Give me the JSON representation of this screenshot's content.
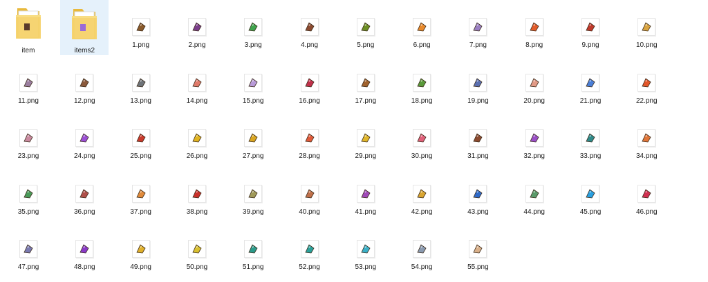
{
  "folders": [
    {
      "name": "item",
      "selected": false
    },
    {
      "name": "items2",
      "selected": true
    }
  ],
  "files": [
    {
      "name": "1.png",
      "icon": "treasure-chest-icon",
      "color": "#8a5a2b"
    },
    {
      "name": "2.png",
      "icon": "potion-bottle-icon",
      "color": "#7a3e8a"
    },
    {
      "name": "3.png",
      "icon": "clover-icon",
      "color": "#3fa34d"
    },
    {
      "name": "4.png",
      "icon": "wood-log-icon",
      "color": "#8b4a2f"
    },
    {
      "name": "5.png",
      "icon": "green-feather-icon",
      "color": "#6b8e23"
    },
    {
      "name": "6.png",
      "icon": "orange-star-icon",
      "color": "#e8892b"
    },
    {
      "name": "7.png",
      "icon": "crystal-gem-icon",
      "color": "#9a7fc2"
    },
    {
      "name": "8.png",
      "icon": "fire-orb-icon",
      "color": "#e25b2a"
    },
    {
      "name": "9.png",
      "icon": "staff-icon",
      "color": "#c0392b"
    },
    {
      "name": "10.png",
      "icon": "map-scroll-icon",
      "color": "#d9a441"
    },
    {
      "name": "11.png",
      "icon": "seashell-icon",
      "color": "#9b7ea0"
    },
    {
      "name": "12.png",
      "icon": "starfish-icon",
      "color": "#8b5a3c"
    },
    {
      "name": "13.png",
      "icon": "stone-pile-icon",
      "color": "#6e7378"
    },
    {
      "name": "14.png",
      "icon": "meat-icon",
      "color": "#e07a6a"
    },
    {
      "name": "15.png",
      "icon": "lilac-shell-icon",
      "color": "#b89ad8"
    },
    {
      "name": "16.png",
      "icon": "red-feather-icon",
      "color": "#c0304a"
    },
    {
      "name": "17.png",
      "icon": "acorn-icon",
      "color": "#a0622d"
    },
    {
      "name": "18.png",
      "icon": "cactus-icon",
      "color": "#5a9a3a"
    },
    {
      "name": "19.png",
      "icon": "blue-boot-icon",
      "color": "#5a6fb0"
    },
    {
      "name": "20.png",
      "icon": "peach-icon",
      "color": "#e29a86"
    },
    {
      "name": "21.png",
      "icon": "blue-crystals-icon",
      "color": "#4a7fd8"
    },
    {
      "name": "22.png",
      "icon": "sun-gem-icon",
      "color": "#e2562a"
    },
    {
      "name": "23.png",
      "icon": "pink-stone-icon",
      "color": "#c98aa0"
    },
    {
      "name": "24.png",
      "icon": "purple-orb-icon",
      "color": "#9b4fd6"
    },
    {
      "name": "25.png",
      "icon": "red-helmet-icon",
      "color": "#c9392b"
    },
    {
      "name": "26.png",
      "icon": "gold-bars-icon",
      "color": "#e0b320"
    },
    {
      "name": "27.png",
      "icon": "gold-ingot-icon",
      "color": "#d9a520"
    },
    {
      "name": "28.png",
      "icon": "red-pearl-icon",
      "color": "#e05a3a"
    },
    {
      "name": "29.png",
      "icon": "gold-coins-icon",
      "color": "#e0b62a"
    },
    {
      "name": "30.png",
      "icon": "pink-flower-icon",
      "color": "#e0607a"
    },
    {
      "name": "31.png",
      "icon": "wood-pieces-icon",
      "color": "#8b4a2f"
    },
    {
      "name": "32.png",
      "icon": "purple-wand-icon",
      "color": "#9a4fc8"
    },
    {
      "name": "33.png",
      "icon": "teal-leaf-icon",
      "color": "#2f8a8a"
    },
    {
      "name": "34.png",
      "icon": "orange-cloth-icon",
      "color": "#e0763a"
    },
    {
      "name": "35.png",
      "icon": "green-jewel-icon",
      "color": "#4a9a5a"
    },
    {
      "name": "36.png",
      "icon": "red-pouch-icon",
      "color": "#b0504a"
    },
    {
      "name": "37.png",
      "icon": "orange-pyramid-icon",
      "color": "#e08a3a"
    },
    {
      "name": "38.png",
      "icon": "red-berry-icon",
      "color": "#c9302a"
    },
    {
      "name": "39.png",
      "icon": "olive-cloth-icon",
      "color": "#a09a5a"
    },
    {
      "name": "40.png",
      "icon": "brown-cloth-icon",
      "color": "#c0704a"
    },
    {
      "name": "41.png",
      "icon": "purple-flask-icon",
      "color": "#a04ab8"
    },
    {
      "name": "42.png",
      "icon": "gold-book-icon",
      "color": "#d9a530"
    },
    {
      "name": "43.png",
      "icon": "blue-shard-icon",
      "color": "#2f6ac8"
    },
    {
      "name": "44.png",
      "icon": "green-hexagon-icon",
      "color": "#5a9a6a"
    },
    {
      "name": "45.png",
      "icon": "cyan-diamond-icon",
      "color": "#2aa0e0"
    },
    {
      "name": "46.png",
      "icon": "red-gem-icon",
      "color": "#d03050"
    },
    {
      "name": "47.png",
      "icon": "silver-pentagon-icon",
      "color": "#7a7ab0"
    },
    {
      "name": "48.png",
      "icon": "purple-pentagon-icon",
      "color": "#8a3ac8"
    },
    {
      "name": "49.png",
      "icon": "yellow-pencil-icon",
      "color": "#e0b02a"
    },
    {
      "name": "50.png",
      "icon": "yellow-rod-icon",
      "color": "#d9c030"
    },
    {
      "name": "51.png",
      "icon": "teal-sword-icon",
      "color": "#2a9a8a"
    },
    {
      "name": "52.png",
      "icon": "teal-axe-icon",
      "color": "#2aa09a"
    },
    {
      "name": "53.png",
      "icon": "aqua-crystal-icon",
      "color": "#3ab0c8"
    },
    {
      "name": "54.png",
      "icon": "grey-stone-icon",
      "color": "#8a9ab0"
    },
    {
      "name": "55.png",
      "icon": "bone-icon",
      "color": "#d9b08a"
    }
  ]
}
